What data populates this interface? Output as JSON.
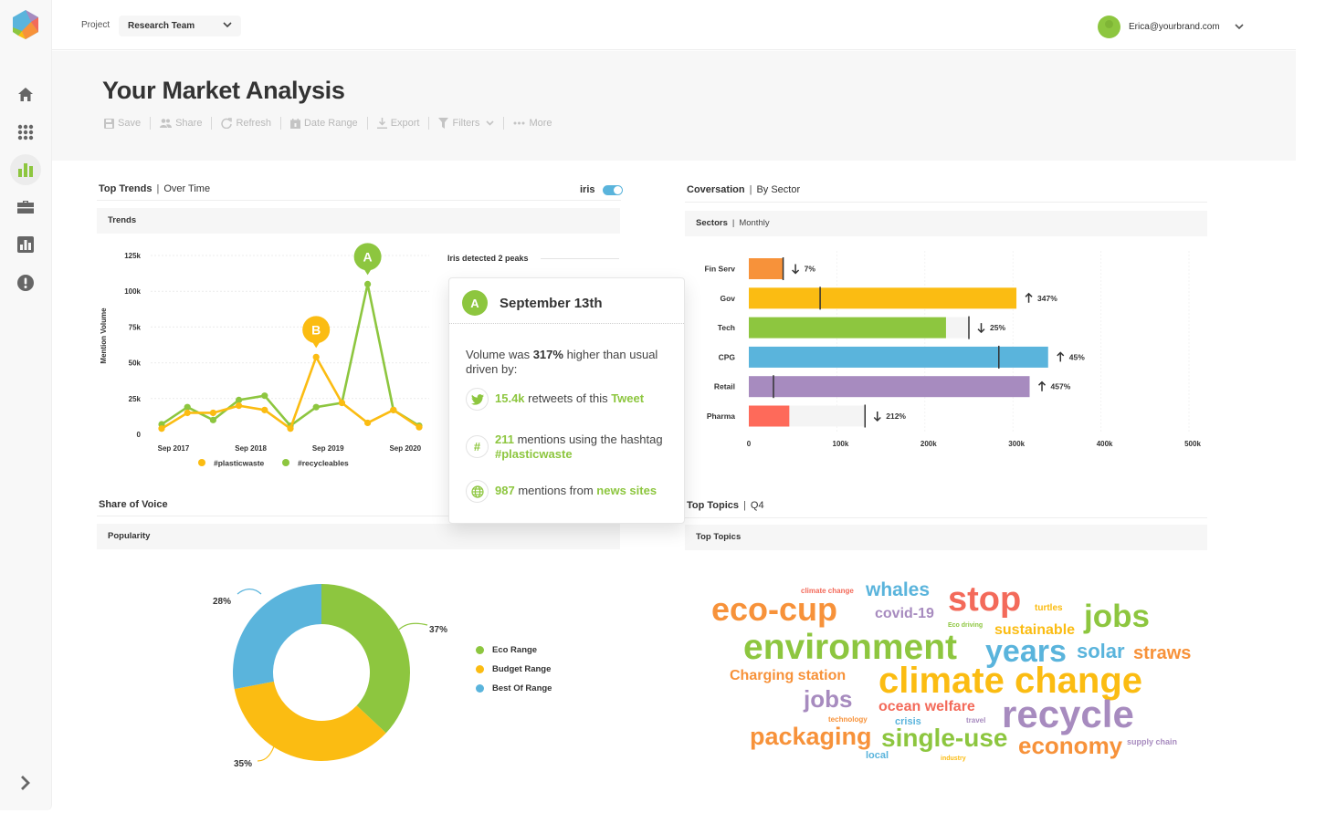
{
  "sidebar": {
    "logo": "hexagon-logo",
    "items": [
      {
        "icon": "home-icon",
        "active": false
      },
      {
        "icon": "apps-grid-icon",
        "active": false
      },
      {
        "icon": "bar-chart-icon",
        "active": true
      },
      {
        "icon": "briefcase-icon",
        "active": false
      },
      {
        "icon": "report-icon",
        "active": false
      },
      {
        "icon": "alert-icon",
        "active": false
      }
    ],
    "expand_icon": "chevron-right-icon"
  },
  "topbar": {
    "project_label": "Project",
    "project_value": "Research Team",
    "user_email": "Erica@yourbrand.com"
  },
  "header": {
    "title": "Your Market Analysis",
    "toolbar": [
      {
        "label": "Save",
        "icon": "save-icon"
      },
      {
        "label": "Share",
        "icon": "share-users-icon"
      },
      {
        "label": "Refresh",
        "icon": "refresh-icon"
      },
      {
        "label": "Date Range",
        "icon": "calendar-icon"
      },
      {
        "label": "Export",
        "icon": "download-icon"
      },
      {
        "label": "Filters",
        "icon": "filter-icon"
      },
      {
        "label": "More",
        "icon": "ellipsis-icon"
      }
    ]
  },
  "trends": {
    "title": "Top Trends",
    "subtitle": "Over Time",
    "toggle_label": "iris",
    "toggle_on": true,
    "subbar": "Trends",
    "peaks_label": "Iris detected 2 peaks",
    "colors": {
      "plasticwaste": "#fbbc12",
      "recycleables": "#8dc63f"
    }
  },
  "tooltip": {
    "badge": "A",
    "date": "September 13th",
    "lead_pre": "Volume was ",
    "lead_bold": "317%",
    "lead_post": " higher than usual driven by:",
    "drivers": [
      {
        "icon": "twitter-icon",
        "highlight": "15.4k",
        "text": " retweets of this ",
        "link": "Tweet"
      },
      {
        "icon": "hashtag-icon",
        "highlight": "211",
        "text": " mentions using the hashtag ",
        "link": "#plasticwaste"
      },
      {
        "icon": "globe-icon",
        "highlight": "987",
        "text": " mentions from ",
        "link": "news sites"
      }
    ]
  },
  "conversation": {
    "title": "Coversation",
    "subtitle": "By Sector",
    "subbar_bold": "Sectors",
    "subbar_light": "Monthly"
  },
  "share_of_voice": {
    "title": "Share of Voice",
    "subbar": "Popularity"
  },
  "top_topics": {
    "title": "Top Topics",
    "subtitle": "Q4",
    "subbar": "Top Topics",
    "words": [
      {
        "text": "climate change",
        "color": "#f36a5a",
        "weight": 1
      },
      {
        "text": "whales",
        "color": "#5ab4dc",
        "weight": 4
      },
      {
        "text": "stop",
        "color": "#f36a5a",
        "weight": 8
      },
      {
        "text": "turtles",
        "color": "#fbbc12",
        "weight": 1.5
      },
      {
        "text": "eco-cup",
        "color": "#f7923a",
        "weight": 8
      },
      {
        "text": "covid-19",
        "color": "#a78bbf",
        "weight": 3.5
      },
      {
        "text": "Eco driving",
        "color": "#8dc63f",
        "weight": 0.8
      },
      {
        "text": "sustainable",
        "color": "#fbbc12",
        "weight": 3.5
      },
      {
        "text": "jobs",
        "color": "#8dc63f",
        "weight": 7
      },
      {
        "text": "environment",
        "color": "#8dc63f",
        "weight": 9
      },
      {
        "text": "years",
        "color": "#5ab4dc",
        "weight": 7
      },
      {
        "text": "solar",
        "color": "#5ab4dc",
        "weight": 4.5
      },
      {
        "text": "straws",
        "color": "#f7923a",
        "weight": 4.5
      },
      {
        "text": "Charging station",
        "color": "#f7923a",
        "weight": 3
      },
      {
        "text": "climate change",
        "color": "#fbbc12",
        "weight": 9
      },
      {
        "text": "jobs",
        "color": "#a78bbf",
        "weight": 5.5
      },
      {
        "text": "ocean welfare",
        "color": "#f36a5a",
        "weight": 3.5
      },
      {
        "text": "technology",
        "color": "#f7923a",
        "weight": 1
      },
      {
        "text": "crisis",
        "color": "#5ab4dc",
        "weight": 1.5
      },
      {
        "text": "travel",
        "color": "#a78bbf",
        "weight": 1
      },
      {
        "text": "recycle",
        "color": "#a78bbf",
        "weight": 9
      },
      {
        "text": "packaging",
        "color": "#f7923a",
        "weight": 6
      },
      {
        "text": "single-use",
        "color": "#8dc63f",
        "weight": 6
      },
      {
        "text": "economy",
        "color": "#f7923a",
        "weight": 5.5
      },
      {
        "text": "supply chain",
        "color": "#a78bbf",
        "weight": 1
      },
      {
        "text": "local",
        "color": "#5ab4dc",
        "weight": 1.5
      },
      {
        "text": "industry",
        "color": "#fbbc12",
        "weight": 0.8
      }
    ]
  },
  "chart_data": [
    {
      "type": "line",
      "title": "Trends",
      "xlabel": "",
      "ylabel": "Mention Volume",
      "ylim": [
        0,
        125000
      ],
      "yticks": [
        "0",
        "25k",
        "50k",
        "75k",
        "100k",
        "125k"
      ],
      "xtick_labels": [
        "Sep 2017",
        "Sep 2018",
        "Sep 2019",
        "Sep 2020"
      ],
      "grid": true,
      "legend": "bottom",
      "series": [
        {
          "name": "#plasticwaste",
          "color": "#fbbc12",
          "values": [
            4000,
            15000,
            15000,
            20000,
            17000,
            4000,
            54000,
            22000,
            8000,
            17000,
            5000
          ]
        },
        {
          "name": "#recycleables",
          "color": "#8dc63f",
          "values": [
            7000,
            19000,
            10000,
            24000,
            27000,
            6000,
            19000,
            22000,
            105000,
            17000,
            6000
          ]
        }
      ],
      "annotations": [
        {
          "label": "A",
          "series": "#recycleables",
          "index": 8,
          "color": "#8dc63f"
        },
        {
          "label": "B",
          "series": "#plasticwaste",
          "index": 6,
          "color": "#fbbc12"
        }
      ]
    },
    {
      "type": "bar",
      "orientation": "horizontal",
      "title": "Sectors | Monthly",
      "xlim": [
        0,
        500000
      ],
      "xticks": [
        "0",
        "100k",
        "200k",
        "300k",
        "400k",
        "500k"
      ],
      "categories": [
        "Fin Serv",
        "Gov",
        "Tech",
        "CPG",
        "Retail",
        "Pharma"
      ],
      "values": [
        39000,
        304000,
        224000,
        340000,
        319000,
        46000
      ],
      "previous": [
        39000,
        81000,
        250000,
        284000,
        28000,
        132000
      ],
      "change_labels": [
        "7%",
        "347%",
        "25%",
        "45%",
        "457%",
        "212%"
      ],
      "change_direction": [
        "down",
        "up",
        "down",
        "up",
        "up",
        "down"
      ],
      "colors": [
        "#f7923a",
        "#fbbc12",
        "#8dc63f",
        "#5ab4dc",
        "#a78bbf",
        "#fe6a5a"
      ]
    },
    {
      "type": "pie",
      "variant": "donut",
      "title": "Popularity",
      "categories": [
        "Eco Range",
        "Budget Range",
        "Best Of Range"
      ],
      "values": [
        37,
        35,
        28
      ],
      "labels": [
        "37%",
        "35%",
        "28%"
      ],
      "colors": [
        "#8dc63f",
        "#fbbc12",
        "#5ab4dc"
      ],
      "legend": "right"
    }
  ]
}
